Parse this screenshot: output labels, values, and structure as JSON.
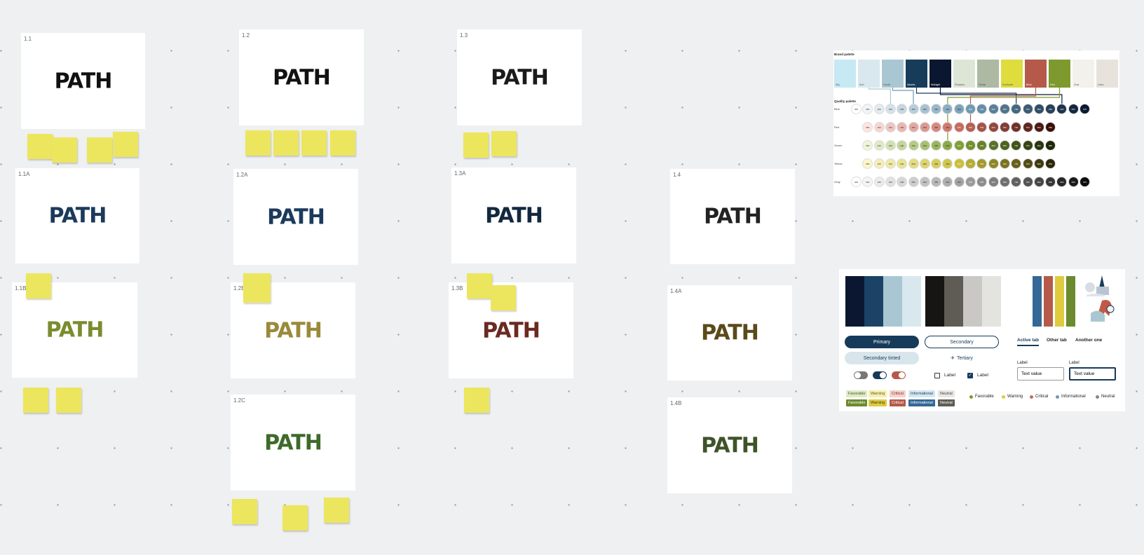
{
  "frames": [
    {
      "id": "f1",
      "label": "1.1",
      "logo": "PATH",
      "color": "#111111"
    },
    {
      "id": "f2",
      "label": "1.2",
      "logo": "PATH",
      "color": "#111111"
    },
    {
      "id": "f3",
      "label": "1.3",
      "logo": "PATH",
      "color": "#1a1a1a"
    },
    {
      "id": "f1A",
      "label": "1.1A",
      "logo": "PATH",
      "color": "#1b3a5c"
    },
    {
      "id": "f2A",
      "label": "1.2A",
      "logo": "PATH",
      "color": "#1b3a5c"
    },
    {
      "id": "f3A",
      "label": "1.3A",
      "logo": "PATH",
      "color": "#13283f"
    },
    {
      "id": "f4",
      "label": "1.4",
      "logo": "PATH",
      "color": "#222222"
    },
    {
      "id": "f1B",
      "label": "1.1B",
      "logo": "PATH",
      "color": "#7a8c2e"
    },
    {
      "id": "f2B",
      "label": "1.2B",
      "logo": "PATH",
      "color": "#9a8a3a"
    },
    {
      "id": "f3B",
      "label": "1.3B",
      "logo": "PATH",
      "color": "#6b2a22"
    },
    {
      "id": "f4A",
      "label": "1.4A",
      "logo": "PATH",
      "color": "#5a4a1a"
    },
    {
      "id": "f2C",
      "label": "1.2C",
      "logo": "PATH",
      "color": "#3f6a2a"
    },
    {
      "id": "f4B",
      "label": "1.4B",
      "logo": "PATH",
      "color": "#3e5428"
    }
  ],
  "palette": {
    "brand_title": "Brand palette",
    "swatches": [
      {
        "name": "Sky",
        "color": "#c6e9f4"
      },
      {
        "name": "Surf",
        "color": "#d9e8ee"
      },
      {
        "name": "Pacific",
        "color": "#a9c7d3"
      },
      {
        "name": "Atlantic",
        "color": "#173c5a"
      },
      {
        "name": "Midnight",
        "color": "#0b1730"
      },
      {
        "name": "Pistachio",
        "color": "#dde6d6"
      },
      {
        "name": "Thistle",
        "color": "#adb9a3"
      },
      {
        "name": "Sunflower",
        "color": "#dfdc3e"
      },
      {
        "name": "Brick",
        "color": "#b55a4a"
      },
      {
        "name": "Fern",
        "color": "#7e9a2e"
      },
      {
        "name": "Chai",
        "color": "#f3f1ec"
      },
      {
        "name": "Linen",
        "color": "#e7e3dc"
      }
    ],
    "quality_title": "Quality palette",
    "steps": [
      "025",
      "050",
      "100",
      "150",
      "200",
      "250",
      "300",
      "350",
      "400",
      "450",
      "500",
      "550",
      "600",
      "650",
      "700",
      "750",
      "800",
      "850",
      "900",
      "950",
      "975"
    ],
    "rows": [
      {
        "name": "Blue",
        "from": "#ffffff",
        "mid": "#6e9ab4",
        "to": "#0a1a33",
        "count": 21
      },
      {
        "name": "Red",
        "from": "#fde5e1",
        "mid": "#c96a5e",
        "to": "#3a0f0a",
        "count": 17
      },
      {
        "name": "Green",
        "from": "#eef5d8",
        "mid": "#7ea034",
        "to": "#1c260b",
        "count": 17
      },
      {
        "name": "Yellow",
        "from": "#fbf6c8",
        "mid": "#c9c03a",
        "to": "#2b270a",
        "count": 17
      },
      {
        "name": "Gray",
        "from": "#ffffff",
        "mid": "#9a9a9a",
        "to": "#0c0c0c",
        "count": 21
      }
    ]
  },
  "design": {
    "ui_swatches": [
      "#0b1730",
      "#1b4366",
      "#a9c7d3",
      "#d9e8ee",
      "#161513",
      "#5e5c55",
      "#c9c8c4",
      "#e3e3e0"
    ],
    "accent_swatches": [
      "#346896",
      "#b55a4a",
      "#dfcb3e",
      "#6c8a2e"
    ],
    "primary": "Primary",
    "secondary": "Secondary",
    "secondary_tinted": "Secondary tinted",
    "tertiary": "Tertiary",
    "tabs": [
      "Active tab",
      "Other tab",
      "Another one"
    ],
    "checkbox_label": "Label",
    "input_label": "Label",
    "input_value": "Text value",
    "tags": [
      "Favorable",
      "Warning",
      "Critical",
      "Informational",
      "Neutral"
    ],
    "dots": [
      "Favorable",
      "Warning",
      "Critical",
      "Informational",
      "Neutral"
    ]
  }
}
